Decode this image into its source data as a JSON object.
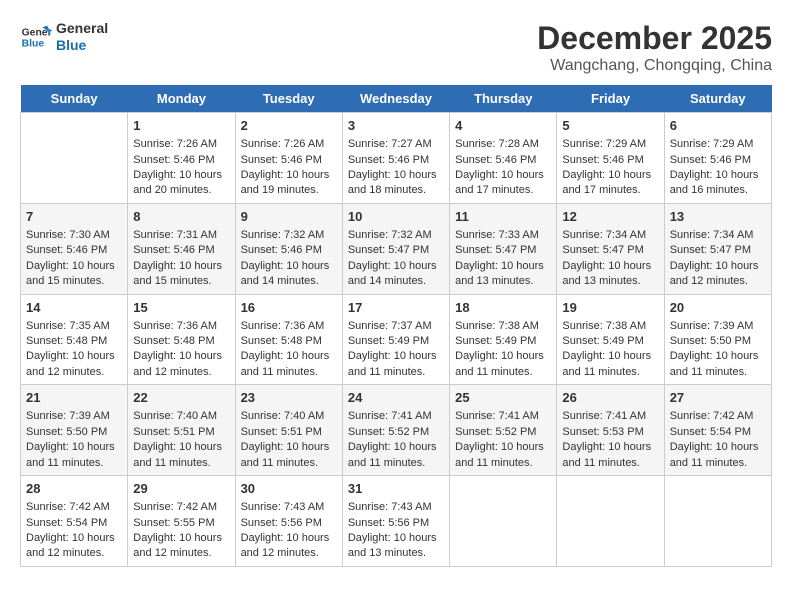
{
  "logo": {
    "line1": "General",
    "line2": "Blue"
  },
  "title": "December 2025",
  "location": "Wangchang, Chongqing, China",
  "days_of_week": [
    "Sunday",
    "Monday",
    "Tuesday",
    "Wednesday",
    "Thursday",
    "Friday",
    "Saturday"
  ],
  "weeks": [
    [
      {
        "day": null
      },
      {
        "day": "1",
        "sunrise": "7:26 AM",
        "sunset": "5:46 PM",
        "daylight": "10 hours and 20 minutes."
      },
      {
        "day": "2",
        "sunrise": "7:26 AM",
        "sunset": "5:46 PM",
        "daylight": "10 hours and 19 minutes."
      },
      {
        "day": "3",
        "sunrise": "7:27 AM",
        "sunset": "5:46 PM",
        "daylight": "10 hours and 18 minutes."
      },
      {
        "day": "4",
        "sunrise": "7:28 AM",
        "sunset": "5:46 PM",
        "daylight": "10 hours and 17 minutes."
      },
      {
        "day": "5",
        "sunrise": "7:29 AM",
        "sunset": "5:46 PM",
        "daylight": "10 hours and 17 minutes."
      },
      {
        "day": "6",
        "sunrise": "7:29 AM",
        "sunset": "5:46 PM",
        "daylight": "10 hours and 16 minutes."
      }
    ],
    [
      {
        "day": "7",
        "sunrise": "7:30 AM",
        "sunset": "5:46 PM",
        "daylight": "10 hours and 15 minutes."
      },
      {
        "day": "8",
        "sunrise": "7:31 AM",
        "sunset": "5:46 PM",
        "daylight": "10 hours and 15 minutes."
      },
      {
        "day": "9",
        "sunrise": "7:32 AM",
        "sunset": "5:46 PM",
        "daylight": "10 hours and 14 minutes."
      },
      {
        "day": "10",
        "sunrise": "7:32 AM",
        "sunset": "5:47 PM",
        "daylight": "10 hours and 14 minutes."
      },
      {
        "day": "11",
        "sunrise": "7:33 AM",
        "sunset": "5:47 PM",
        "daylight": "10 hours and 13 minutes."
      },
      {
        "day": "12",
        "sunrise": "7:34 AM",
        "sunset": "5:47 PM",
        "daylight": "10 hours and 13 minutes."
      },
      {
        "day": "13",
        "sunrise": "7:34 AM",
        "sunset": "5:47 PM",
        "daylight": "10 hours and 12 minutes."
      }
    ],
    [
      {
        "day": "14",
        "sunrise": "7:35 AM",
        "sunset": "5:48 PM",
        "daylight": "10 hours and 12 minutes."
      },
      {
        "day": "15",
        "sunrise": "7:36 AM",
        "sunset": "5:48 PM",
        "daylight": "10 hours and 12 minutes."
      },
      {
        "day": "16",
        "sunrise": "7:36 AM",
        "sunset": "5:48 PM",
        "daylight": "10 hours and 11 minutes."
      },
      {
        "day": "17",
        "sunrise": "7:37 AM",
        "sunset": "5:49 PM",
        "daylight": "10 hours and 11 minutes."
      },
      {
        "day": "18",
        "sunrise": "7:38 AM",
        "sunset": "5:49 PM",
        "daylight": "10 hours and 11 minutes."
      },
      {
        "day": "19",
        "sunrise": "7:38 AM",
        "sunset": "5:49 PM",
        "daylight": "10 hours and 11 minutes."
      },
      {
        "day": "20",
        "sunrise": "7:39 AM",
        "sunset": "5:50 PM",
        "daylight": "10 hours and 11 minutes."
      }
    ],
    [
      {
        "day": "21",
        "sunrise": "7:39 AM",
        "sunset": "5:50 PM",
        "daylight": "10 hours and 11 minutes."
      },
      {
        "day": "22",
        "sunrise": "7:40 AM",
        "sunset": "5:51 PM",
        "daylight": "10 hours and 11 minutes."
      },
      {
        "day": "23",
        "sunrise": "7:40 AM",
        "sunset": "5:51 PM",
        "daylight": "10 hours and 11 minutes."
      },
      {
        "day": "24",
        "sunrise": "7:41 AM",
        "sunset": "5:52 PM",
        "daylight": "10 hours and 11 minutes."
      },
      {
        "day": "25",
        "sunrise": "7:41 AM",
        "sunset": "5:52 PM",
        "daylight": "10 hours and 11 minutes."
      },
      {
        "day": "26",
        "sunrise": "7:41 AM",
        "sunset": "5:53 PM",
        "daylight": "10 hours and 11 minutes."
      },
      {
        "day": "27",
        "sunrise": "7:42 AM",
        "sunset": "5:54 PM",
        "daylight": "10 hours and 11 minutes."
      }
    ],
    [
      {
        "day": "28",
        "sunrise": "7:42 AM",
        "sunset": "5:54 PM",
        "daylight": "10 hours and 12 minutes."
      },
      {
        "day": "29",
        "sunrise": "7:42 AM",
        "sunset": "5:55 PM",
        "daylight": "10 hours and 12 minutes."
      },
      {
        "day": "30",
        "sunrise": "7:43 AM",
        "sunset": "5:56 PM",
        "daylight": "10 hours and 12 minutes."
      },
      {
        "day": "31",
        "sunrise": "7:43 AM",
        "sunset": "5:56 PM",
        "daylight": "10 hours and 13 minutes."
      },
      {
        "day": null
      },
      {
        "day": null
      },
      {
        "day": null
      }
    ]
  ],
  "labels": {
    "sunrise_prefix": "Sunrise: ",
    "sunset_prefix": "Sunset: ",
    "daylight_prefix": "Daylight: "
  }
}
